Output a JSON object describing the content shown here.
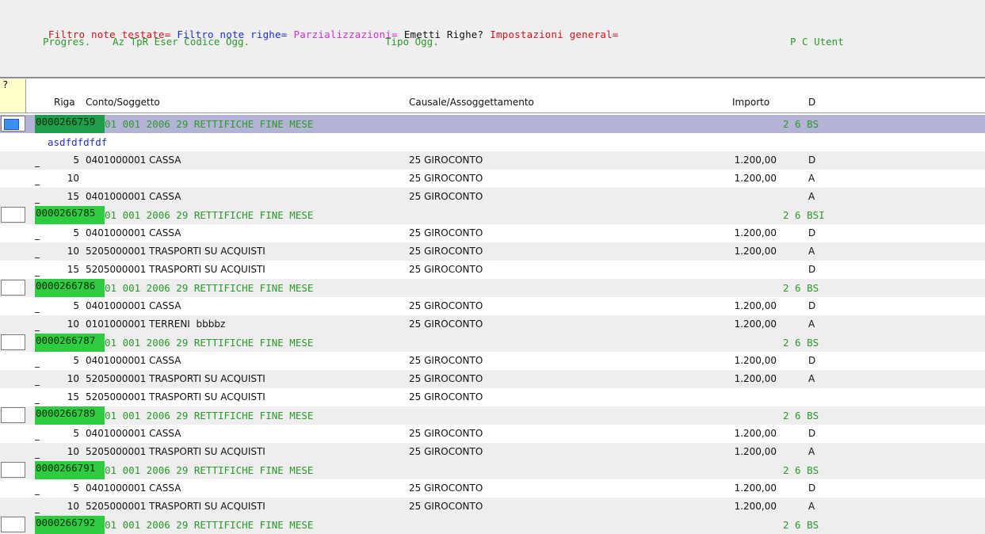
{
  "filters": [
    {
      "label": "Filtro note testate=",
      "color": "#d4141c"
    },
    {
      "label": "Filtro note righe=",
      "color": "#1b2fd0"
    },
    {
      "label": "Parzializzazioni=",
      "color": "#cc33cc"
    },
    {
      "label": "Emetti Righe?",
      "color": "#111111"
    },
    {
      "label": "Impostazioni general=",
      "color": "#d4141c"
    }
  ],
  "header_cols": {
    "progres": "Progres.",
    "az_tpr": "Az TpR Eser Codice Ogg.",
    "tipo": "Tipo Ogg.",
    "pc_utent": "P C Utent"
  },
  "corner_label": "?",
  "columns": {
    "riga": "Riga",
    "conto": "Conto/Soggetto",
    "causale": "Causale/Assoggettamento",
    "importo": "Importo",
    "d": "D"
  },
  "rows": [
    {
      "type": "head",
      "selected": true,
      "checked": true,
      "prog": "0000266759",
      "desc": "01 001 2006 29 RETTIFICHE FINE MESE",
      "pc": "2 6 BS"
    },
    {
      "type": "note",
      "text": "asdfdfdfdf"
    },
    {
      "type": "line",
      "dash": "_",
      "riga": "5",
      "conto": "0401000001 CASSA",
      "causale": "25 GIROCONTO",
      "importo": "1.200,00",
      "d": "D"
    },
    {
      "type": "line",
      "dash": "_",
      "riga": "10",
      "conto": "",
      "causale": "25 GIROCONTO",
      "importo": "1.200,00",
      "d": "A"
    },
    {
      "type": "line",
      "dash": "_",
      "riga": "15",
      "conto": "0401000001 CASSA",
      "causale": "25 GIROCONTO",
      "importo": "",
      "d": "A"
    },
    {
      "type": "head",
      "selected": false,
      "checked": false,
      "prog": "0000266785",
      "desc": "01 001 2006 29 RETTIFICHE FINE MESE",
      "pc": "2 6 BSI"
    },
    {
      "type": "line",
      "dash": "_",
      "riga": "5",
      "conto": "0401000001 CASSA",
      "causale": "25 GIROCONTO",
      "importo": "1.200,00",
      "d": "D"
    },
    {
      "type": "line",
      "dash": "_",
      "riga": "10",
      "conto": "5205000001 TRASPORTI SU ACQUISTI",
      "causale": "25 GIROCONTO",
      "importo": "1.200,00",
      "d": "A"
    },
    {
      "type": "line",
      "dash": "_",
      "riga": "15",
      "conto": "5205000001 TRASPORTI SU ACQUISTI",
      "causale": "25 GIROCONTO",
      "importo": "",
      "d": "D"
    },
    {
      "type": "head",
      "selected": false,
      "checked": false,
      "prog": "0000266786",
      "desc": "01 001 2006 29 RETTIFICHE FINE MESE",
      "pc": "2 6 BS"
    },
    {
      "type": "line",
      "dash": "_",
      "riga": "5",
      "conto": "0401000001 CASSA",
      "causale": "25 GIROCONTO",
      "importo": "1.200,00",
      "d": "D"
    },
    {
      "type": "line",
      "dash": "_",
      "riga": "10",
      "conto": "0101000001 TERRENI  bbbbz",
      "causale": "25 GIROCONTO",
      "importo": "1.200,00",
      "d": "A"
    },
    {
      "type": "head",
      "selected": false,
      "checked": false,
      "prog": "0000266787",
      "desc": "01 001 2006 29 RETTIFICHE FINE MESE",
      "pc": "2 6 BS"
    },
    {
      "type": "line",
      "dash": "_",
      "riga": "5",
      "conto": "0401000001 CASSA",
      "causale": "25 GIROCONTO",
      "importo": "1.200,00",
      "d": "D"
    },
    {
      "type": "line",
      "dash": "_",
      "riga": "10",
      "conto": "5205000001 TRASPORTI SU ACQUISTI",
      "causale": "25 GIROCONTO",
      "importo": "1.200,00",
      "d": "A"
    },
    {
      "type": "line",
      "dash": "_",
      "riga": "15",
      "conto": "5205000001 TRASPORTI SU ACQUISTI",
      "causale": "25 GIROCONTO",
      "importo": "",
      "d": ""
    },
    {
      "type": "head",
      "selected": false,
      "checked": false,
      "prog": "0000266789",
      "desc": "01 001 2006 29 RETTIFICHE FINE MESE",
      "pc": "2 6 BS"
    },
    {
      "type": "line",
      "dash": "_",
      "riga": "5",
      "conto": "0401000001 CASSA",
      "causale": "25 GIROCONTO",
      "importo": "1.200,00",
      "d": "D"
    },
    {
      "type": "line",
      "dash": "_",
      "riga": "10",
      "conto": "5205000001 TRASPORTI SU ACQUISTI",
      "causale": "25 GIROCONTO",
      "importo": "1.200,00",
      "d": "A"
    },
    {
      "type": "head",
      "selected": false,
      "checked": false,
      "prog": "0000266791",
      "desc": "01 001 2006 29 RETTIFICHE FINE MESE",
      "pc": "2 6 BS"
    },
    {
      "type": "line",
      "dash": "_",
      "riga": "5",
      "conto": "0401000001 CASSA",
      "causale": "25 GIROCONTO",
      "importo": "1.200,00",
      "d": "D"
    },
    {
      "type": "line",
      "dash": "_",
      "riga": "10",
      "conto": "5205000001 TRASPORTI SU ACQUISTI",
      "causale": "25 GIROCONTO",
      "importo": "1.200,00",
      "d": "A"
    },
    {
      "type": "head",
      "selected": false,
      "checked": false,
      "prog": "0000266792",
      "desc": "01 001 2006 29 RETTIFICHE FINE MESE",
      "pc": "2 6 BS"
    }
  ]
}
